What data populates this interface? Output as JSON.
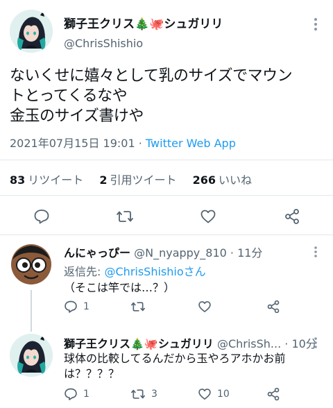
{
  "main_tweet": {
    "display_name": "獅子王クリス🎄🐙シュガリリ",
    "handle": "@ChrisShishio",
    "text": "ないくせに嬉々として乳のサイズでマウン\nトとってくるなや\n金玉のサイズ書けや",
    "timestamp": "2021年07月15日 19:01",
    "separator": "·",
    "source": "Twitter Web App",
    "retweets_count": "83",
    "retweets_label": "リツイート",
    "quotes_count": "2",
    "quotes_label": "引用ツイート",
    "likes_count": "266",
    "likes_label": "いいね"
  },
  "replies": [
    {
      "display_name": "んにゃっぴー",
      "handle_time": "@N_nyappy_810 · 11分",
      "reply_to_label": "返信先:",
      "reply_to_handle": "@ChrisShishio",
      "reply_to_suffix": "さん",
      "text": "（そこは竿では…？）",
      "reply_count": "1",
      "retweet_count": "",
      "like_count": ""
    },
    {
      "display_name": "獅子王クリス🎄🐙シュガリリ",
      "handle_time": "@ChrisSh... · 10分",
      "text": "球体の比較してるんだから玉やろアホかお前は？？？？",
      "reply_count": "1",
      "retweet_count": "3",
      "like_count": "10"
    }
  ],
  "icons": {
    "more": "more-icon",
    "reply": "reply-icon",
    "retweet": "retweet-icon",
    "like": "heart-icon",
    "share": "share-icon"
  },
  "colors": {
    "link": "#1d9bf0",
    "secondary_text": "#536471",
    "divider": "#e1e8ed"
  }
}
